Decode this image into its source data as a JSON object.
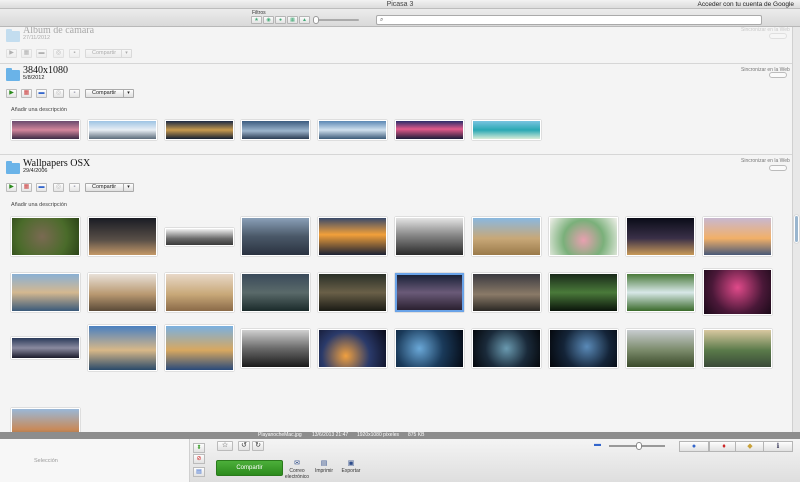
{
  "window": {
    "title": "Picasa 3",
    "account_link": "Acceder con tu cuenta de Google"
  },
  "filterbar": {
    "label": "Filtros",
    "buttons": [
      {
        "icon": "star-icon",
        "glyph": "★"
      },
      {
        "icon": "video-icon",
        "glyph": "◉"
      },
      {
        "icon": "person-icon",
        "glyph": "●"
      },
      {
        "icon": "map-icon",
        "glyph": "▦"
      },
      {
        "icon": "pin-icon",
        "glyph": "▲"
      }
    ],
    "search_placeholder": ""
  },
  "albums": [
    {
      "title": "Álbum de cámara",
      "date": "27/11/2012",
      "sync_label": "Sincronizar en la Web",
      "share_label": "Compartir"
    },
    {
      "title": "3840x1080",
      "date": "5/8/2012",
      "sync_label": "Sincronizar en la Web",
      "share_label": "Compartir",
      "add_description": "Añadir una descripción"
    },
    {
      "title": "Wallpapers OSX",
      "date": "29/4/2006",
      "sync_label": "Sincronizar en la Web",
      "share_label": "Compartir",
      "add_description": "Añadir una descripción"
    }
  ],
  "status": {
    "filename": "PlayanocheMac.jpg",
    "datetime": "13/6/2013 21:47",
    "dimensions": "1920x1080 píxeles",
    "filesize": "875 KB"
  },
  "tray": {
    "selection_label": "Selección",
    "share_button": "Compartir",
    "actions": [
      {
        "label": "Correo electrónico",
        "icon": "mail-icon",
        "glyph": "✉"
      },
      {
        "label": "Imprimir",
        "icon": "printer-icon",
        "glyph": "▤"
      },
      {
        "label": "Exportar",
        "icon": "export-folder-icon",
        "glyph": "▣"
      }
    ]
  },
  "colors": {
    "share_green": "#3a9e2a",
    "folder_blue": "#6ab3e8",
    "selection_blue": "#6aa3e8"
  }
}
